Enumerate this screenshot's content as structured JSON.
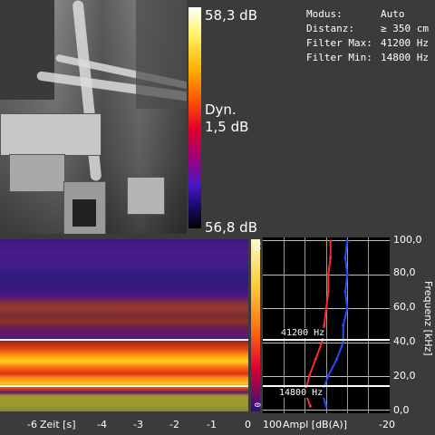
{
  "colorbar": {
    "max_label": "58,3 dB",
    "dyn_label": "Dyn.",
    "dyn_value": "1,5 dB",
    "min_label": "56,8 dB"
  },
  "info": {
    "rows": [
      {
        "key": "Modus:",
        "value": "Auto"
      },
      {
        "key": "Distanz:",
        "value": "≥ 350 cm"
      },
      {
        "key": "Filter Max:",
        "value": "41200 Hz"
      },
      {
        "key": "Filter Min:",
        "value": "14800 Hz"
      }
    ]
  },
  "spectrogram": {
    "x_ticks": [
      "-6",
      "-4",
      "-3",
      "-2",
      "-1",
      "0"
    ],
    "x_label": "Zeit [s]"
  },
  "ampl_panel": {
    "filter_max_label": "41200 Hz",
    "filter_min_label": "14800 Hz",
    "mini_top": "80",
    "mini_bottom": "0",
    "x_left": "100",
    "x_label": "Ampl [dB(A)]",
    "x_right": "-20"
  },
  "freq_axis": {
    "ticks": [
      "100,0",
      "80,0",
      "60,0",
      "40,0",
      "20,0",
      "0,0"
    ],
    "label": "Frequenz [kHz]"
  },
  "chart_data": {
    "type": "line",
    "title": "",
    "xlabel": "Ampl [dB(A)]",
    "ylabel": "Frequenz [kHz]",
    "xlim": [
      100,
      -20
    ],
    "ylim": [
      0,
      100
    ],
    "y": [
      2,
      10,
      20,
      30,
      40,
      50,
      60,
      70,
      80,
      90,
      100
    ],
    "series": [
      {
        "color": "#ff2a2a",
        "values": [
          55,
          60,
          56,
          50,
          44,
          42,
          40,
          38,
          38,
          36,
          36
        ]
      },
      {
        "color": "#2a4cff",
        "values": [
          40,
          44,
          38,
          30,
          24,
          24,
          20,
          22,
          20,
          22,
          20
        ]
      }
    ],
    "filter_max_khz": 41.2,
    "filter_min_khz": 14.8,
    "colors": {
      "red": "#ff2a2a",
      "blue": "#2a4cff"
    }
  }
}
